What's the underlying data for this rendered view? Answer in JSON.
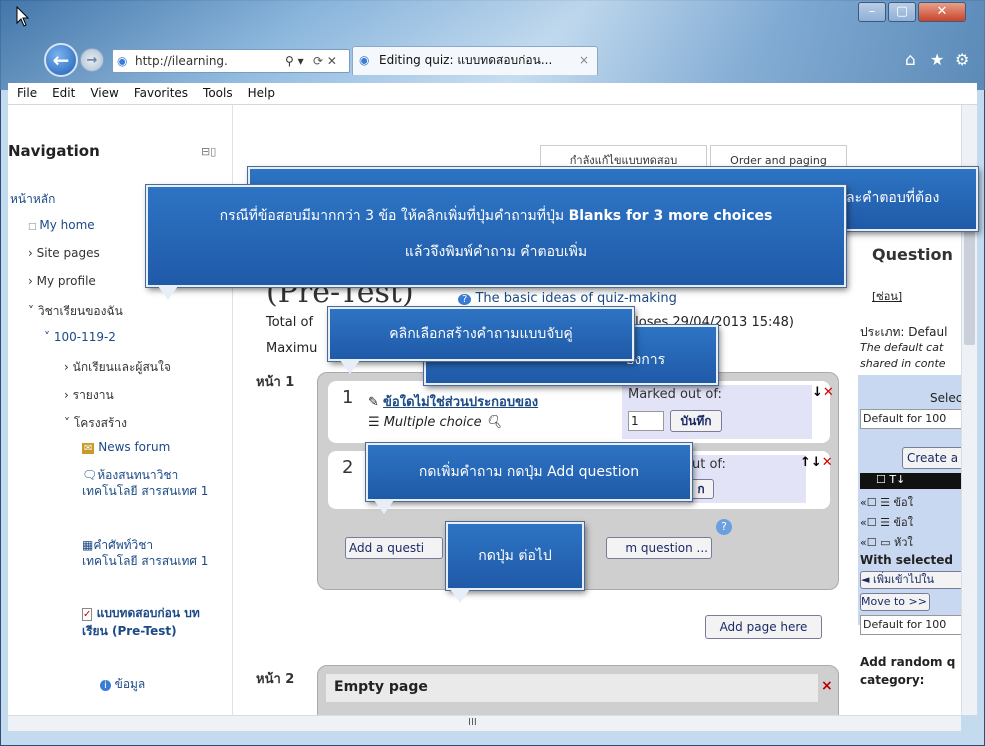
{
  "browser": {
    "url": "http://ilearning.",
    "tab_title": "Editing quiz: แบบทดสอบก่อน...",
    "tab_close": "×",
    "menu": [
      "File",
      "Edit",
      "View",
      "Favorites",
      "Tools",
      "Help"
    ],
    "scroll_mid": "III"
  },
  "nav": {
    "title": "Navigation",
    "home": "หน้าหลัก",
    "my_home": "My home",
    "site_pages": "Site pages",
    "my_profile": "My profile",
    "my_courses": "วิชาเรียนของฉัน",
    "course": "100-119-2",
    "participants": "นักเรียนและผู้สนใจ",
    "reports": "รายงาน",
    "structure": "โครงสร้าง",
    "news_forum": "News forum",
    "forum2": "ห้องสนทนาวิชา เทคโนโลยี สารสนเทศ 1",
    "glossary": "คำศัพท์วิชา เทคโนโลยี สารสนเทศ 1",
    "quiz": "แบบทดสอบก่อน บทเรียน (Pre-Test)",
    "info": "ข้อมูล"
  },
  "main": {
    "tab_edit": "กำลังแก้ไขแบบทดสอบ",
    "tab_order": "Order and paging",
    "title": "(Pre-Test)",
    "help_link": "The basic ideas of quiz-making",
    "total_prefix": "Total of",
    "closes": "closes 29/04/2013 15:48)",
    "maximum": "Maximu",
    "need": "องการ",
    "page1": "หน้า 1",
    "page2": "หน้า 2",
    "q1_num": "1",
    "q1_title": "ข้อใดไม่ใช่ส่วนประกอบของ",
    "q1_type": "Multiple choice",
    "q1_marked_label": "Marked out of:",
    "q1_mark": "1",
    "save": "บันทึก",
    "q2_num": "2",
    "q2_marked": "ut of:",
    "q2_save": "ก",
    "add_question": "Add a questi",
    "add_random": "m question ...",
    "add_page": "Add page here",
    "empty_page": "Empty page",
    "delete": "×"
  },
  "right": {
    "question": "Question",
    "hide": "[ซ่อน]",
    "category_label": "ประเภท: Defaul",
    "default_cat": "The default cat",
    "shared": "shared in conte",
    "select_label": "Selec",
    "default_for": "Default for 100",
    "create": "Create a",
    "header_t": "T",
    "row1": "ข้อใ",
    "row2": "ข้อใ",
    "row3": "หัวใ",
    "with_selected": "With selected",
    "add_to": "◄ เพิ่มเข้าไปใน",
    "move_to": "Move to >>",
    "default_for2": "Default for 100",
    "add_random_q": "Add random q",
    "category": "category:"
  },
  "callouts": {
    "top_text": "กรณีที่ข้อสอบมีมากกว่า 3 ข้อ ให้คลิกเพิ่มที่ปุ่มคำถามที่ปุ่ม ",
    "top_bold": "Blanks for 3 more choices",
    "top_line2": "แล้วจึงพิมพ์คำถาม คำตอบเพิ่ม",
    "behind_text": "ละคำตอบที่ต้อง",
    "match": "คลิกเลือกสร้างคำถามแบบจับคู่",
    "add_q": "กดเพิ่มคำถาม กดปุ่ม Add question",
    "next": "กดปุ่ม ต่อไป"
  },
  "colors": {
    "callout": "#2468b8",
    "link": "#1b4a86"
  }
}
